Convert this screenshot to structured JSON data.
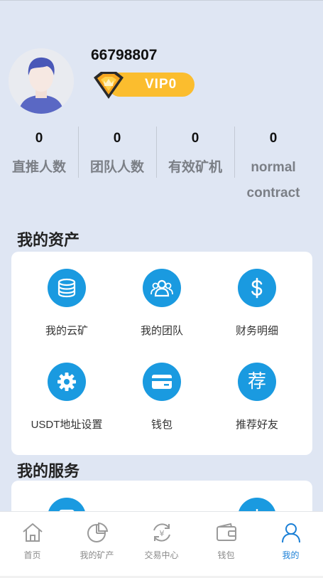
{
  "profile": {
    "user_id": "66798807",
    "vip_level": "VIP0",
    "avatar_icon": "user-avatar-icon"
  },
  "stats": [
    {
      "value": "0",
      "label": "直推人数"
    },
    {
      "value": "0",
      "label": "团队人数"
    },
    {
      "value": "0",
      "label": "有效矿机"
    },
    {
      "value": "0",
      "label": "normal contract"
    }
  ],
  "assets": {
    "title": "我的资产",
    "items": [
      {
        "label": "我的云矿",
        "icon": "database-icon"
      },
      {
        "label": "我的团队",
        "icon": "team-icon"
      },
      {
        "label": "财务明细",
        "icon": "dollar-icon"
      },
      {
        "label": "USDT地址设置",
        "icon": "gear-icon"
      },
      {
        "label": "钱包",
        "icon": "card-icon"
      },
      {
        "label": "推荐好友",
        "icon": "recommend-icon",
        "glyph": "荐"
      }
    ]
  },
  "services": {
    "title": "我的服务"
  },
  "bottom_nav": [
    {
      "label": "首页",
      "icon": "home-icon",
      "active": false
    },
    {
      "label": "我的矿产",
      "icon": "pie-chart-icon",
      "active": false
    },
    {
      "label": "交易中心",
      "icon": "exchange-icon",
      "active": false
    },
    {
      "label": "钱包",
      "icon": "wallet-icon",
      "active": false
    },
    {
      "label": "我的",
      "icon": "user-icon",
      "active": true
    }
  ],
  "colors": {
    "background": "#dfe6f3",
    "accent": "#1a9ae0",
    "vip": "#fbbd2e",
    "nav_active": "#1a7fd6",
    "nav_inactive": "#8a8a8a"
  }
}
